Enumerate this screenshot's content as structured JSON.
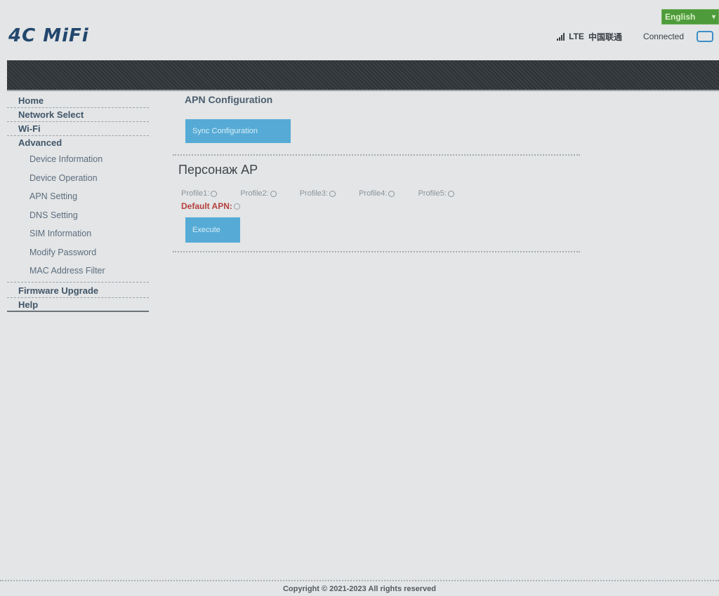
{
  "header": {
    "logo": "4C MiFi",
    "language": "English",
    "network_type": "LTE",
    "carrier": "中国联通",
    "connection_status": "Connected"
  },
  "sidebar": {
    "items": [
      {
        "label": "Home"
      },
      {
        "label": "Network Select"
      },
      {
        "label": "Wi-Fi"
      },
      {
        "label": "Advanced"
      }
    ],
    "advanced_sub": [
      "Device Information",
      "Device Operation",
      "APN Setting",
      "DNS Setting",
      "SIM Information",
      "Modify Password",
      "MAC Address Filter"
    ],
    "bottom_items": [
      {
        "label": "Firmware Upgrade"
      },
      {
        "label": "Help"
      }
    ]
  },
  "main": {
    "section_title": "APN Configuration",
    "sync_button": "Sync Configuration",
    "ap_heading": "Персонаж AP",
    "profiles": [
      "Profile1:",
      "Profile2:",
      "Profile3:",
      "Profile4:",
      "Profile5:"
    ],
    "default_apn": "Default APN:",
    "execute_button": "Execute"
  },
  "footer": {
    "copyright": "Copyright © 2021-2023 All rights reserved"
  },
  "colors": {
    "accent": "#56abd6",
    "language_bg": "#4d9b3a",
    "default_apn": "#b5403e",
    "logo": "#23476e"
  }
}
